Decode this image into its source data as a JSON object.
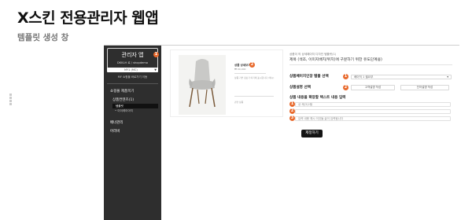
{
  "slide": {
    "title": "X스킨 전용관리자 웹앱",
    "subtitle": "템플릿 생성 창"
  },
  "sidebar": {
    "admin_title": "관리자 앱",
    "admin_user": "DKKLH 로 / shopdemo",
    "shop_select_value": "MY1 (MC)",
    "shop_button_label": "MY 쇼핑몰 바로가기 이동",
    "section_label": "쇼핑몰 제품목기",
    "sub_menu_label": "상품컨텐츠(1)",
    "active_item_label": "템플릿",
    "sub_item_label": "• 이이레이아지",
    "main_item_1": "배너관리",
    "main_item_2": "어러비"
  },
  "preview": {
    "title": "상품 상세보기",
    "price": "₩ 00,000",
    "description": "상품 기본 정보가 여기에 표시됩니다 (예시)",
    "footer": "관련 상품"
  },
  "form": {
    "header_small": "상품이 의 상세페이지 디자인 템플릿(1)",
    "header_main": "제목 (색조, 이미지배치/위치)에 구분하기 위한 유도단계용)",
    "row1_label": "상품페이지인장 템플 선택",
    "row1_select_value": "베이직 1 필요부",
    "row2_label": "상품설명 선택",
    "row2_option1": "고객설명 작성",
    "row2_option2": "단어설명 작성",
    "row3_label": "상품 내용을 확장할 텍스트 내용 입력",
    "input1_value": "상 제(3)2필",
    "input2_value": "",
    "input3_value": "입력 내용 예시 이것들 글이 입력됩니다",
    "generate_button": "제정하기"
  },
  "badges": [
    "1",
    "2",
    "3"
  ],
  "colors": {
    "accent": "#e8692c",
    "sidebar_bg": "#2e2e2e",
    "button_bg": "#141414"
  }
}
